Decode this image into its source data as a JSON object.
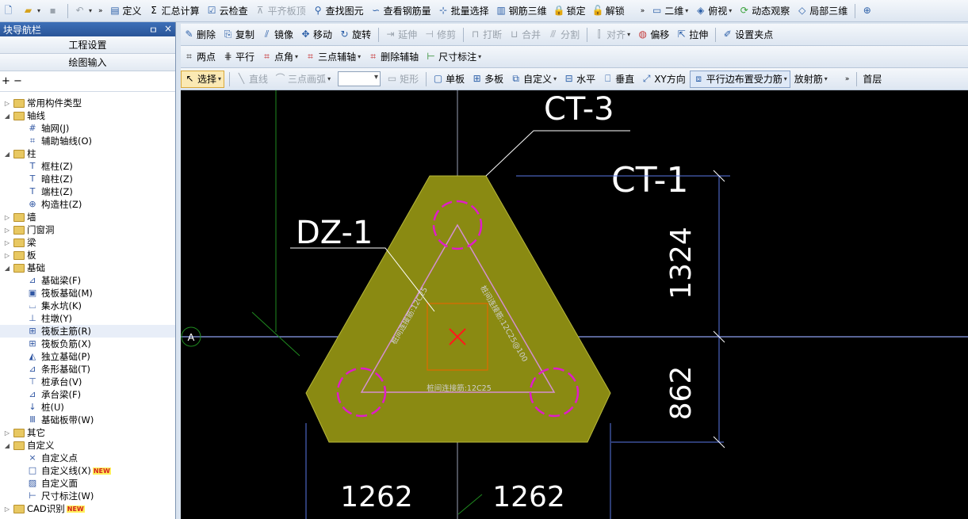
{
  "toolbar1": {
    "items": [
      "定义",
      "汇总计算",
      "云检查",
      "平齐板顶",
      "查找图元",
      "查看钢筋量",
      "批量选择",
      "钢筋三维",
      "锁定",
      "解锁"
    ],
    "right_items": [
      "二维",
      "俯视",
      "动态观察",
      "局部三维"
    ]
  },
  "toolbar2": {
    "items": [
      "删除",
      "复制",
      "镜像",
      "移动",
      "旋转",
      "延伸",
      "修剪",
      "打断",
      "合并",
      "分割",
      "对齐",
      "偏移",
      "拉伸",
      "设置夹点"
    ]
  },
  "toolbar3": {
    "items": [
      "两点",
      "平行",
      "点角",
      "三点辅轴",
      "删除辅轴",
      "尺寸标注"
    ]
  },
  "toolbar4": {
    "items": [
      "选择",
      "直线",
      "三点画弧",
      "矩形",
      "单板",
      "多板",
      "自定义",
      "水平",
      "垂直",
      "XY方向",
      "平行边布置受力筋",
      "放射筋"
    ],
    "floor": "首层"
  },
  "nav": {
    "title": "块导航栏",
    "pin": "ㅁ",
    "close": "×",
    "btn_project": "工程设置",
    "btn_draw": "绘图输入",
    "tools": "+ −"
  },
  "tree": [
    {
      "level": 0,
      "label": "常用构件类型",
      "exp": "▷",
      "folder": true
    },
    {
      "level": 0,
      "label": "轴线",
      "exp": "◢",
      "folder": true
    },
    {
      "level": 1,
      "label": "轴网(J)",
      "icon": "#"
    },
    {
      "level": 1,
      "label": "辅助轴线(O)",
      "icon": "⌗"
    },
    {
      "level": 0,
      "label": "柱",
      "exp": "◢",
      "folder": true
    },
    {
      "level": 1,
      "label": "框柱(Z)",
      "icon": "T"
    },
    {
      "level": 1,
      "label": "暗柱(Z)",
      "icon": "T"
    },
    {
      "level": 1,
      "label": "端柱(Z)",
      "icon": "T"
    },
    {
      "level": 1,
      "label": "构造柱(Z)",
      "icon": "⊕"
    },
    {
      "level": 0,
      "label": "墙",
      "exp": "▷",
      "folder": true
    },
    {
      "level": 0,
      "label": "门窗洞",
      "exp": "▷",
      "folder": true
    },
    {
      "level": 0,
      "label": "梁",
      "exp": "▷",
      "folder": true
    },
    {
      "level": 0,
      "label": "板",
      "exp": "▷",
      "folder": true
    },
    {
      "level": 0,
      "label": "基础",
      "exp": "◢",
      "folder": true
    },
    {
      "level": 1,
      "label": "基础梁(F)",
      "icon": "⊿"
    },
    {
      "level": 1,
      "label": "筏板基础(M)",
      "icon": "▣"
    },
    {
      "level": 1,
      "label": "集水坑(K)",
      "icon": "⌴"
    },
    {
      "level": 1,
      "label": "柱墩(Y)",
      "icon": "⊥"
    },
    {
      "level": 1,
      "label": "筏板主筋(R)",
      "icon": "⊞",
      "selected": true
    },
    {
      "level": 1,
      "label": "筏板负筋(X)",
      "icon": "⊞"
    },
    {
      "level": 1,
      "label": "独立基础(P)",
      "icon": "◭"
    },
    {
      "level": 1,
      "label": "条形基础(T)",
      "icon": "⊿"
    },
    {
      "level": 1,
      "label": "桩承台(V)",
      "icon": "⊤"
    },
    {
      "level": 1,
      "label": "承台梁(F)",
      "icon": "⊿"
    },
    {
      "level": 1,
      "label": "桩(U)",
      "icon": "↓"
    },
    {
      "level": 1,
      "label": "基础板带(W)",
      "icon": "Ⅲ"
    },
    {
      "level": 0,
      "label": "其它",
      "exp": "▷",
      "folder": true
    },
    {
      "level": 0,
      "label": "自定义",
      "exp": "◢",
      "folder": true
    },
    {
      "level": 1,
      "label": "自定义点",
      "icon": "×"
    },
    {
      "level": 1,
      "label": "自定义线(X)",
      "icon": "□",
      "badge": "NEW"
    },
    {
      "level": 1,
      "label": "自定义面",
      "icon": "▨"
    },
    {
      "level": 1,
      "label": "尺寸标注(W)",
      "icon": "⊢"
    },
    {
      "level": 0,
      "label": "CAD识别",
      "exp": "▷",
      "folder": true,
      "badge": "NEW"
    }
  ],
  "drawing": {
    "label_ct3": "CT-3",
    "label_ct1": "CT-1",
    "label_dz1": "DZ-1",
    "axis_label": "A",
    "dim_top": "1324",
    "dim_bottom_right": "862",
    "dim_left": "1262",
    "dim_right": "1262",
    "rebar_left": "桩间连接筋:12C25",
    "rebar_right": "桩间连接筋:12C25@100",
    "rebar_bottom": "桩间连接筋:12C25",
    "colors": {
      "cap_fill": "#8a8a12",
      "pile": "#e01cc8",
      "axis": "#5a78e6",
      "dim": "#5a78e6",
      "text": "#ffffff",
      "column": "#e06a00",
      "marker": "#ff1a1a"
    }
  }
}
